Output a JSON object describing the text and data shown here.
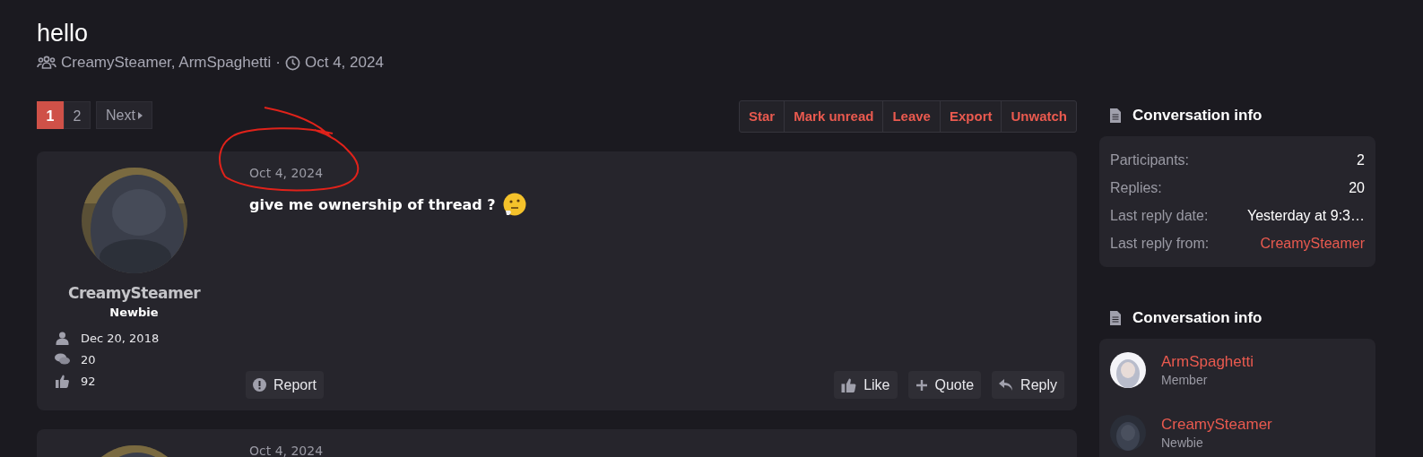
{
  "thread": {
    "title": "hello",
    "participants": "CreamySteamer, ArmSpaghetti",
    "separator": "·",
    "date": "Oct 4, 2024"
  },
  "pagination": {
    "pages": [
      {
        "label": "1",
        "selected": true
      },
      {
        "label": "2",
        "selected": false
      }
    ],
    "next": "Next"
  },
  "actions": [
    "Star",
    "Mark unread",
    "Leave",
    "Export",
    "Unwatch"
  ],
  "posts": [
    {
      "author": "CreamySteamer",
      "role": "Newbie",
      "joined": "Dec 20, 2018",
      "messages": "20",
      "reactions": "92",
      "date": "Oct 4, 2024",
      "text": "give me ownership of thread ?",
      "report": "Report",
      "buttons": [
        {
          "kind": "like",
          "label": "Like"
        },
        {
          "kind": "quote",
          "label": "Quote"
        },
        {
          "kind": "reply",
          "label": "Reply"
        }
      ]
    },
    {
      "date": "Oct 4, 2024"
    }
  ],
  "sidebar": [
    {
      "title": "Conversation info",
      "kind": "stats",
      "rows": [
        {
          "label": "Participants:",
          "value": "2",
          "link": false
        },
        {
          "label": "Replies:",
          "value": "20",
          "link": false
        },
        {
          "label": "Last reply date:",
          "value": "Yesterday at 9:3…",
          "link": false
        },
        {
          "label": "Last reply from:",
          "value": "CreamySteamer",
          "link": true
        }
      ]
    },
    {
      "title": "Conversation info",
      "kind": "people",
      "people": [
        {
          "name": "ArmSpaghetti",
          "role": "Member"
        },
        {
          "name": "CreamySteamer",
          "role": "Newbie"
        }
      ]
    }
  ]
}
